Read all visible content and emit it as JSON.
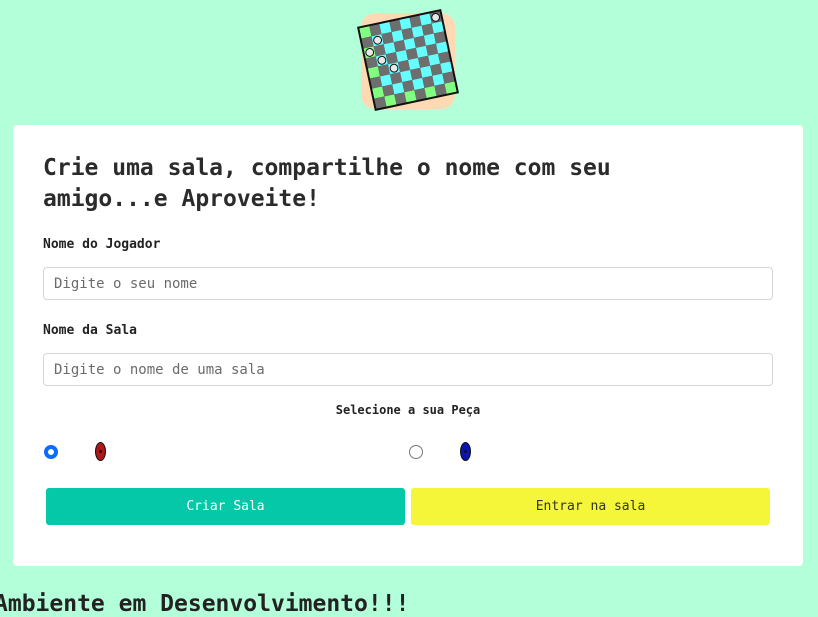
{
  "header": {
    "logo_icon": "checkerboard-logo-icon"
  },
  "form": {
    "title": "Crie uma sala, compartilhe o nome com seu amigo...e Aproveite!",
    "player_label": "Nome do Jogador",
    "player_placeholder": "Digite o seu nome",
    "room_label": "Nome da Sala",
    "room_placeholder": "Digite o nome de uma sala",
    "piece_label": "Selecione a sua Peça",
    "pieces": [
      {
        "name": "red-piece-icon",
        "color": "#b01818",
        "selected": true
      },
      {
        "name": "blue-piece-icon",
        "color": "#0a14b0",
        "selected": false
      }
    ],
    "create_button": "Criar Sala",
    "enter_button": "Entrar na sala"
  },
  "footer": {
    "text": "Ambiente em Desenvolvimento!!!"
  },
  "colors": {
    "background": "#b3ffd9",
    "create_button": "#05c8a8",
    "enter_button": "#f5f53a",
    "radio_selected": "#0a6cff"
  }
}
